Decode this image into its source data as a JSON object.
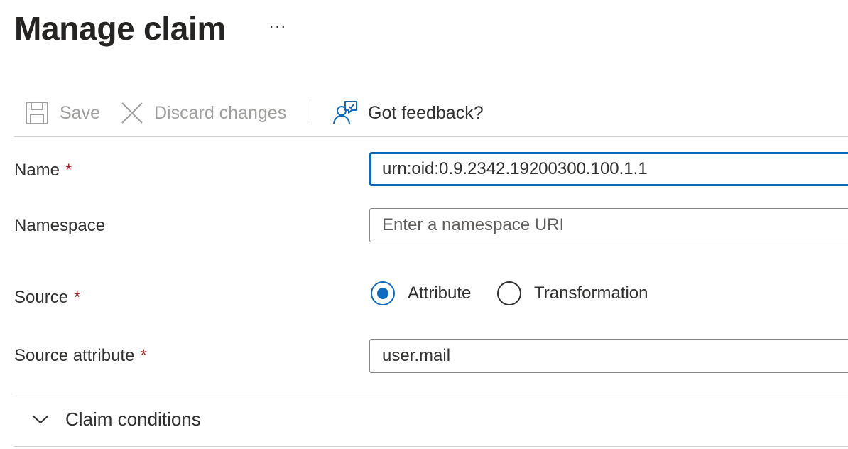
{
  "header": {
    "title": "Manage claim",
    "more_label": "···"
  },
  "toolbar": {
    "save_label": "Save",
    "discard_label": "Discard changes",
    "feedback_label": "Got feedback?"
  },
  "form": {
    "name": {
      "label": "Name",
      "required_mark": "*",
      "value": "urn:oid:0.9.2342.19200300.100.1.1"
    },
    "namespace": {
      "label": "Namespace",
      "placeholder": "Enter a namespace URI",
      "value": ""
    },
    "source": {
      "label": "Source",
      "required_mark": "*",
      "options": [
        {
          "label": "Attribute",
          "selected": true
        },
        {
          "label": "Transformation",
          "selected": false
        }
      ]
    },
    "source_attribute": {
      "label": "Source attribute",
      "required_mark": "*",
      "value": "user.mail"
    }
  },
  "claim_conditions": {
    "label": "Claim conditions",
    "expanded": false
  },
  "colors": {
    "accent": "#0f6cbd",
    "required": "#a4262c",
    "disabled_text": "#a19f9d",
    "text": "#323130",
    "divider": "#d2d0ce"
  }
}
